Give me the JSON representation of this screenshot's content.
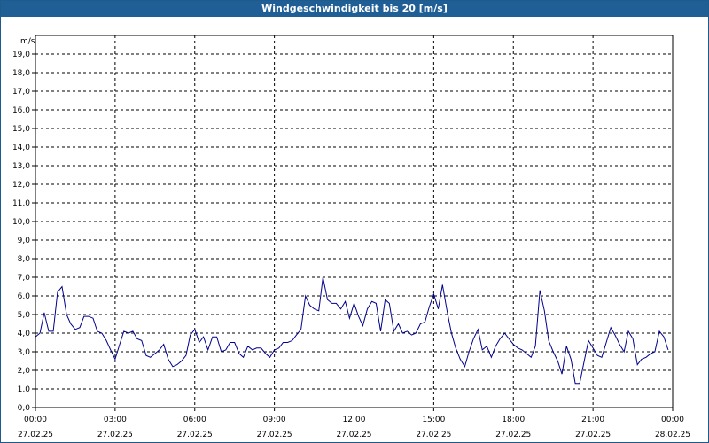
{
  "window": {
    "title": "Windgeschwindigkeit bis 20 [m/s]"
  },
  "chart_data": {
    "type": "line",
    "ylabel": "m/s",
    "ylim": [
      0,
      20
    ],
    "yticks": [
      "0,0",
      "1,0",
      "2,0",
      "3,0",
      "4,0",
      "5,0",
      "6,0",
      "7,0",
      "8,0",
      "9,0",
      "10,0",
      "11,0",
      "12,0",
      "13,0",
      "14,0",
      "15,0",
      "16,0",
      "17,0",
      "18,0",
      "19,0"
    ],
    "xlim_hours": [
      0,
      24
    ],
    "xticks": [
      {
        "time": "00:00",
        "date": "27.02.25"
      },
      {
        "time": "03:00",
        "date": "27.02.25"
      },
      {
        "time": "06:00",
        "date": "27.02.25"
      },
      {
        "time": "09:00",
        "date": "27.02.25"
      },
      {
        "time": "12:00",
        "date": "27.02.25"
      },
      {
        "time": "15:00",
        "date": "27.02.25"
      },
      {
        "time": "18:00",
        "date": "27.02.25"
      },
      {
        "time": "21:00",
        "date": "27.02.25"
      },
      {
        "time": "00:00",
        "date": "28.02.25"
      }
    ],
    "grid": true,
    "series": [
      {
        "color": "#00008b",
        "x_hours": [
          0.0,
          0.17,
          0.33,
          0.5,
          0.67,
          0.83,
          1.0,
          1.17,
          1.33,
          1.5,
          1.67,
          1.83,
          2.0,
          2.17,
          2.33,
          2.5,
          2.67,
          2.83,
          3.0,
          3.17,
          3.33,
          3.5,
          3.67,
          3.83,
          4.0,
          4.17,
          4.33,
          4.5,
          4.67,
          4.83,
          5.0,
          5.17,
          5.33,
          5.5,
          5.67,
          5.83,
          6.0,
          6.17,
          6.33,
          6.5,
          6.67,
          6.83,
          7.0,
          7.17,
          7.33,
          7.5,
          7.67,
          7.83,
          8.0,
          8.17,
          8.33,
          8.5,
          8.67,
          8.83,
          9.0,
          9.17,
          9.33,
          9.5,
          9.67,
          9.83,
          10.0,
          10.17,
          10.33,
          10.5,
          10.67,
          10.83,
          11.0,
          11.17,
          11.33,
          11.5,
          11.67,
          11.83,
          12.0,
          12.17,
          12.33,
          12.5,
          12.67,
          12.83,
          13.0,
          13.17,
          13.33,
          13.5,
          13.67,
          13.83,
          14.0,
          14.17,
          14.33,
          14.5,
          14.67,
          14.83,
          15.0,
          15.17,
          15.33,
          15.5,
          15.67,
          15.83,
          16.0,
          16.17,
          16.33,
          16.5,
          16.67,
          16.83,
          17.0,
          17.17,
          17.33,
          17.5,
          17.67,
          17.83,
          18.0,
          18.17,
          18.33,
          18.5,
          18.67,
          18.83,
          19.0,
          19.17,
          19.33,
          19.5,
          19.67,
          19.83,
          20.0,
          20.17,
          20.33,
          20.5,
          20.67,
          20.83,
          21.0,
          21.17,
          21.33,
          21.5,
          21.67,
          21.83,
          22.0,
          22.17,
          22.33,
          22.5,
          22.67,
          22.83,
          23.0,
          23.17,
          23.33,
          23.5,
          23.67,
          23.83
        ],
        "values": [
          3.8,
          4.0,
          5.1,
          4.1,
          4.1,
          6.2,
          6.5,
          5.0,
          4.5,
          4.2,
          4.3,
          4.9,
          4.9,
          4.8,
          4.1,
          4.0,
          3.6,
          3.1,
          2.6,
          3.4,
          4.1,
          4.0,
          4.1,
          3.7,
          3.6,
          2.8,
          2.7,
          2.9,
          3.1,
          3.4,
          2.6,
          2.2,
          2.3,
          2.5,
          2.8,
          3.9,
          4.2,
          3.5,
          3.8,
          3.1,
          3.8,
          3.8,
          3.0,
          3.1,
          3.5,
          3.5,
          2.9,
          2.7,
          3.3,
          3.1,
          3.2,
          3.2,
          2.9,
          2.7,
          3.1,
          3.2,
          3.5,
          3.5,
          3.6,
          3.9,
          4.2,
          6.0,
          5.5,
          5.3,
          5.2,
          7.0,
          5.8,
          5.6,
          5.6,
          5.3,
          5.7,
          4.8,
          5.6,
          4.9,
          4.4,
          5.3,
          5.7,
          5.6,
          4.1,
          5.8,
          5.6,
          4.1,
          4.5,
          4.0,
          4.1,
          3.9,
          4.0,
          4.5,
          4.6,
          5.4,
          6.1,
          5.3,
          6.6,
          5.2,
          4.0,
          3.2,
          2.6,
          2.2,
          3.0,
          3.7,
          4.2,
          3.1,
          3.3,
          2.7,
          3.3,
          3.7,
          4.0,
          3.7,
          3.4,
          3.2,
          3.1,
          2.9,
          2.7,
          3.3,
          6.3,
          5.2,
          3.6,
          3.0,
          2.5,
          1.8,
          3.3,
          2.6,
          1.3,
          1.3,
          2.5,
          3.6,
          3.2,
          2.8,
          2.7,
          3.5,
          4.3,
          3.9,
          3.4,
          3.0,
          4.1,
          3.7,
          2.3,
          2.6,
          2.7,
          2.9,
          3.0,
          4.1,
          3.8,
          3.1
        ]
      }
    ]
  }
}
